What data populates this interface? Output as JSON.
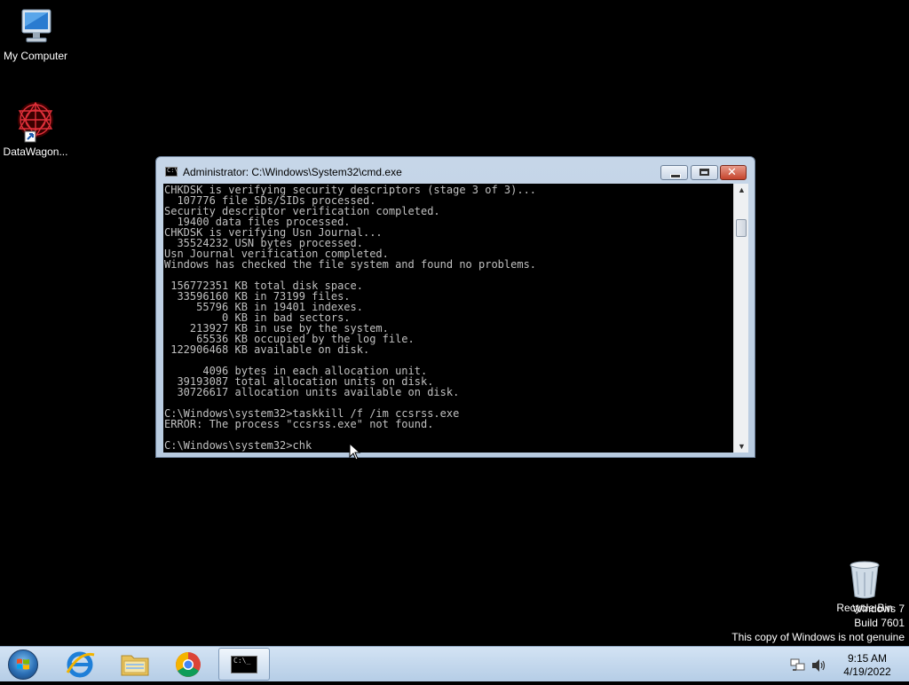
{
  "desktop": {
    "icons": [
      {
        "label": "My Computer"
      },
      {
        "label": "DataWagon..."
      },
      {
        "label": "Recycle Bin"
      }
    ],
    "watermark": {
      "line1": "Windows 7",
      "line2": "Build 7601",
      "line3": "This copy of Windows is not genuine"
    }
  },
  "cmd_window": {
    "title": "Administrator: C:\\Windows\\System32\\cmd.exe",
    "title_icon_text": "C:\\",
    "close_glyph": "✕",
    "console_text": "CHKDSK is verifying security descriptors (stage 3 of 3)...\n  107776 file SDs/SIDs processed.\nSecurity descriptor verification completed.\n  19400 data files processed.\nCHKDSK is verifying Usn Journal...\n  35524232 USN bytes processed.\nUsn Journal verification completed.\nWindows has checked the file system and found no problems.\n\n 156772351 KB total disk space.\n  33596160 KB in 73199 files.\n     55796 KB in 19401 indexes.\n         0 KB in bad sectors.\n    213927 KB in use by the system.\n     65536 KB occupied by the log file.\n 122906468 KB available on disk.\n\n      4096 bytes in each allocation unit.\n  39193087 total allocation units on disk.\n  30726617 allocation units available on disk.\n\nC:\\Windows\\system32>taskkill /f /im ccsrss.exe\nERROR: The process \"ccsrss.exe\" not found.\n\nC:\\Windows\\system32>chk",
    "scroll_up_glyph": "▲",
    "scroll_down_glyph": "▼"
  },
  "taskbar": {
    "cmd_button_text": "C:\\_",
    "clock": {
      "time": "9:15 AM",
      "date": "4/19/2022"
    }
  }
}
